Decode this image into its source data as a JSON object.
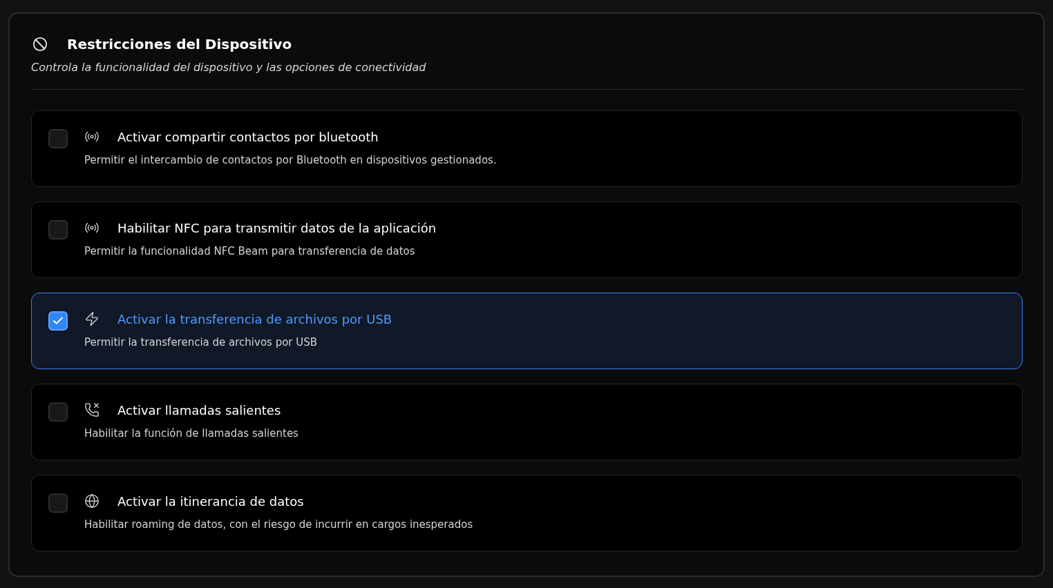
{
  "section": {
    "title": "Restricciones del Dispositivo",
    "subtitle": "Controla la funcionalidad del dispositivo y las opciones de conectividad"
  },
  "options": [
    {
      "kind": "broadcast",
      "label": "Activar compartir contactos por bluetooth",
      "description": "Permitir el intercambio de contactos por Bluetooth en dispositivos gestionados.",
      "checked": false
    },
    {
      "kind": "broadcast",
      "label": "Habilitar NFC para transmitir datos de la aplicación",
      "description": "Permitir la funcionalidad NFC Beam para transferencia de datos",
      "checked": false
    },
    {
      "kind": "bolt",
      "label": "Activar la transferencia de archivos por USB",
      "description": "Permitir la transferencia de archivos por USB",
      "checked": true
    },
    {
      "kind": "phone",
      "label": "Activar llamadas salientes",
      "description": "Habilitar la función de llamadas salientes",
      "checked": false
    },
    {
      "kind": "globe",
      "label": "Activar la itinerancia de datos",
      "description": "Habilitar roaming de datos, con el riesgo de incurrir en cargos inesperados",
      "checked": false
    }
  ]
}
